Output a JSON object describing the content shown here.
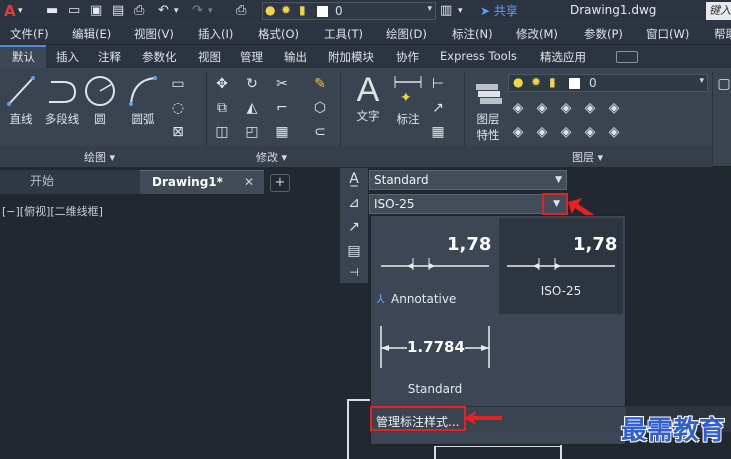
{
  "qat": {
    "layer_value": "0",
    "share": "共享",
    "title": "Drawing1.dwg",
    "search_placeholder": "键入"
  },
  "menu": [
    "文件(F)",
    "编辑(E)",
    "视图(V)",
    "插入(I)",
    "格式(O)",
    "工具(T)",
    "绘图(D)",
    "标注(N)",
    "修改(M)",
    "参数(P)",
    "窗口(W)",
    "帮助"
  ],
  "ribbon_tabs": [
    "默认",
    "插入",
    "注释",
    "参数化",
    "视图",
    "管理",
    "输出",
    "附加模块",
    "协作",
    "Express Tools",
    "精选应用"
  ],
  "ribbon": {
    "draw_tools": [
      "直线",
      "多段线",
      "圆",
      "圆弧"
    ],
    "draw_panel": "绘图 ▾",
    "modify_panel": "修改 ▾",
    "text_tool": "文字",
    "dim_tool": "标注",
    "layer_props_1": "图层",
    "layer_props_2": "特性",
    "layer_panel": "图层 ▾",
    "layer_value": "0"
  },
  "doc_tabs": {
    "start": "开始",
    "drawing": "Drawing1*",
    "close": "✕",
    "add": "+"
  },
  "viewport_label": "[−][俯视][二维线框]",
  "text_style": "Standard",
  "dim_style": "ISO-25",
  "gallery": {
    "items": [
      {
        "name": "Annotative",
        "sample": "1,78"
      },
      {
        "name": "ISO-25",
        "sample": "1,78"
      },
      {
        "name": "Standard",
        "sample": "1.7784"
      }
    ],
    "manage": "管理标注样式..."
  },
  "watermark": "最需教育",
  "colors": {
    "highlight": "#e52222",
    "accent": "#4a90e2",
    "watermark": "#2f5fd0"
  }
}
